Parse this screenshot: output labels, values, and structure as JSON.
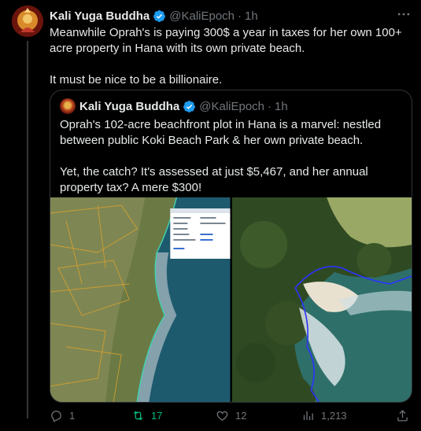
{
  "tweet": {
    "author_name": "Kali Yuga Buddha",
    "handle": "@KaliEpoch",
    "separator": "·",
    "time": "1h",
    "text": "Meanwhile Oprah's is paying 300$ a year in taxes for her own 100+ acre property in Hana with its own private beach.\n\nIt must be nice to be a billionaire."
  },
  "quote": {
    "author_name": "Kali Yuga Buddha",
    "handle": "@KaliEpoch",
    "separator": "·",
    "time": "1h",
    "text": "Oprah's 102-acre beachfront plot in Hana is a marvel: nestled between public Koki Beach Park & her own private beach.\n\nYet, the catch? It's assessed at just $5,467, and her annual property tax? A mere $300!",
    "parcel_popup": {
      "title": "Parcel: 1400020010000",
      "rows": [
        "Gross Area: 102.09",
        "Owner 1: KINGDOM CO",
        "Owner 2:",
        "qPublic Link: View info",
        "Google Street View: View info"
      ],
      "zoom": "Zoom to"
    }
  },
  "actions": {
    "replies": "1",
    "retweets": "17",
    "likes": "12",
    "views": "1,213"
  },
  "colors": {
    "background": "#000000",
    "text": "#e7e9ea",
    "muted": "#71767b",
    "verified": "#1d9bf0",
    "retweet_active": "#00ba7c",
    "border": "#2f3336"
  }
}
